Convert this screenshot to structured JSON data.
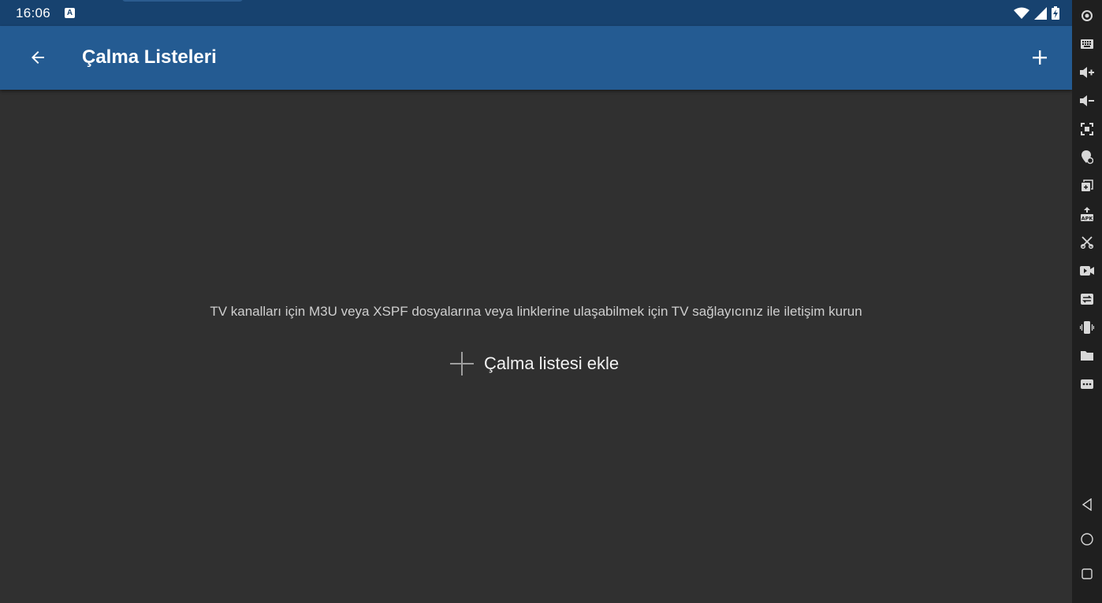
{
  "status_bar": {
    "time": "16:06",
    "notification_glyph": "A",
    "icons": [
      "wifi-icon",
      "signal-icon",
      "battery-charging-icon"
    ]
  },
  "app_bar": {
    "title": "Çalma Listeleri",
    "back_icon": "arrow-back-icon",
    "add_icon": "plus-icon"
  },
  "empty_state": {
    "message": "TV kanalları için M3U veya XSPF dosyalarına veya linklerine ulaşabilmek için TV sağlayıcınız ile iletişim kurun",
    "add_label": "Çalma listesi ekle",
    "add_icon": "plus-icon"
  },
  "emulator_toolbar": {
    "tools": [
      "power-icon",
      "keyboard-icon",
      "volume-up-icon",
      "volume-down-icon",
      "screenshot-icon",
      "location-icon",
      "rotate-icon",
      "apk-install-icon",
      "cut-icon",
      "screen-record-icon",
      "data-toggle-icon",
      "shake-icon",
      "folder-icon",
      "more-icon"
    ],
    "nav": [
      "back-triangle-icon",
      "home-circle-icon",
      "recents-square-icon"
    ]
  },
  "colors": {
    "status_bar": "#17426f",
    "app_bar": "#245b92",
    "background": "#303030",
    "toolbar": "#1f1f1f"
  }
}
